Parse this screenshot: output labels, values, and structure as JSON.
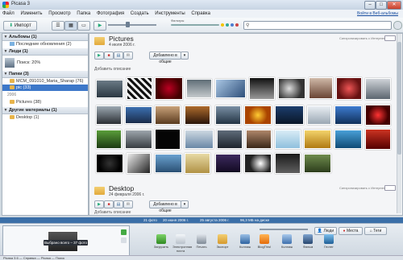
{
  "window": {
    "title": "Picasa 3",
    "minimize": "–",
    "maximize": "□",
    "close": "✕"
  },
  "menu": {
    "items": [
      "Файл",
      "Изменить",
      "Просмотр",
      "Папка",
      "Фотография",
      "Создать",
      "Инструменты",
      "Справка"
    ],
    "signin": "Войти в Веб-альбомы"
  },
  "toolbar": {
    "import_label": "Импорт",
    "filters_label": "Фильтры",
    "search_placeholder": ""
  },
  "sidebar": {
    "albums_header": "Альбомы (1)",
    "albums_item": "Последние обновления (2)",
    "people_header": "Люди (1)",
    "person_label": "Поиск: 20%",
    "folders_header": "Папки (3)",
    "folder_item_1": "MCM_091010_Maria_Sharap (76)",
    "folder_item_2": "pic (33)",
    "year": "2006",
    "folder_item_3": "Pictures (38)",
    "other_header": "Другие материалы (1)",
    "other_item": "Desktop (1)"
  },
  "main": {
    "folder1": {
      "name": "Pictures",
      "date": "4 июля 2006 г.",
      "sync": "Синхронизировать с Интернетом",
      "action": "Добавлено в общие",
      "add_desc": "Добавить описание"
    },
    "folder2": {
      "name": "Desktop",
      "date": "24 февраля 2006 г.",
      "sync": "Синхронизировать с Интернетом",
      "action": "Добавлено в общие",
      "add_desc": "Добавить описание"
    }
  },
  "statusbar": {
    "seg1": "21 фото",
    "seg2": "20 июня 2006 г.",
    "seg3": "25 августа 2006 г.",
    "seg4": "96,3 МБ на диске"
  },
  "tray": {
    "tooltip": "Выбрано всего – 37 фото",
    "tag_people": "Люди",
    "tag_places": "Места",
    "tag_tags": "Теги",
    "items": [
      "Загрузить",
      "Электронная почта",
      "Печать",
      "Экспорт",
      "Коллаж",
      "BlogThis!",
      "Коллаж",
      "Фильм",
      "Геотег"
    ]
  },
  "taskstrip": {
    "text": "Picasa 3.6 — Справка — Picasa — Поиск"
  },
  "colors": {
    "accent": "#3d78c9",
    "status": "#3b6fa8"
  }
}
